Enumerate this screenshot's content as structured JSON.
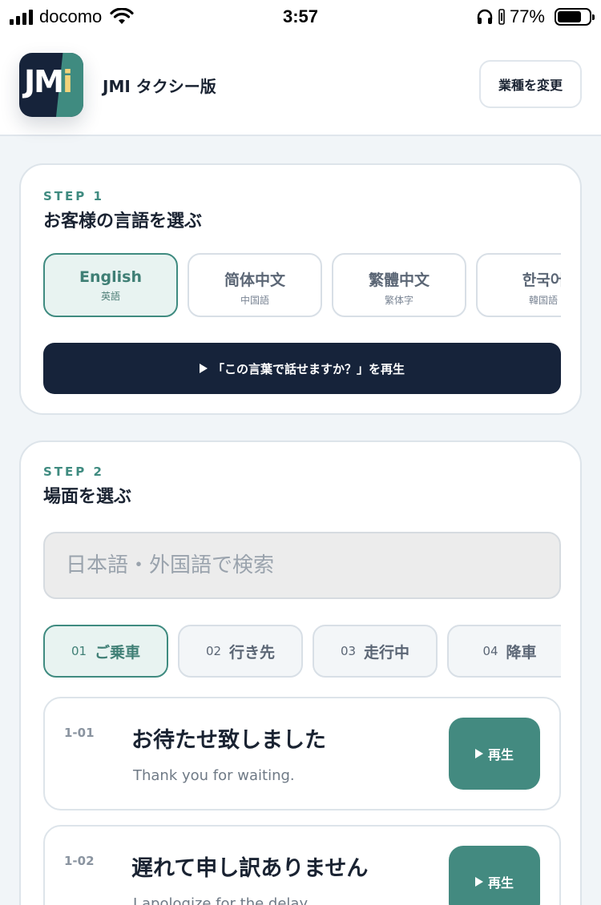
{
  "status_bar": {
    "carrier": "docomo",
    "time": "3:57",
    "battery": "77%"
  },
  "header": {
    "logo_text": "JM",
    "logo_text_i": "i",
    "title": "JMI タクシー版",
    "change_button": "業種を変更"
  },
  "step1": {
    "label": "STEP 1",
    "title": "お客様の言語を選ぶ",
    "languages": [
      {
        "name": "English",
        "sub": "英語",
        "selected": true
      },
      {
        "name": "简体中文",
        "sub": "中国語",
        "selected": false
      },
      {
        "name": "繁體中文",
        "sub": "繁体字",
        "selected": false
      },
      {
        "name": "한국어",
        "sub": "韓国語",
        "selected": false
      }
    ],
    "play_question": "「この言葉で話せますか？」を再生"
  },
  "step2": {
    "label": "STEP 2",
    "title": "場面を選ぶ",
    "search_placeholder": "日本語・外国語で検索",
    "scenes": [
      {
        "num": "01",
        "label": "ご乗車",
        "selected": true
      },
      {
        "num": "02",
        "label": "行き先",
        "selected": false
      },
      {
        "num": "03",
        "label": "走行中",
        "selected": false
      },
      {
        "num": "04",
        "label": "降車",
        "selected": false
      }
    ],
    "phrases": [
      {
        "id": "1-01",
        "jp": "お待たせ致しました",
        "en": "Thank you for waiting.",
        "play": "再生"
      },
      {
        "id": "1-02",
        "jp": "遅れて申し訳ありません",
        "en": "I apologize for the delay.",
        "play": "再生"
      }
    ]
  },
  "colors": {
    "accent": "#3f8b80",
    "navy": "#16233a",
    "selected_bg": "#e8f3f1"
  }
}
